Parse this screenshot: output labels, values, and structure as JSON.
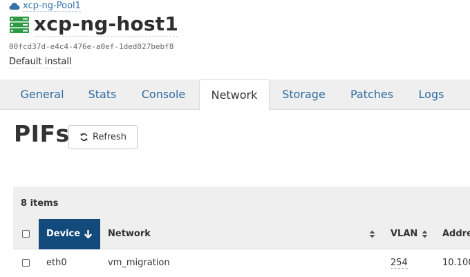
{
  "header": {
    "pool_name": "xcp-ng-Pool1",
    "host_name": "xcp-ng-host1",
    "uuid": "00fcd37d-e4c4-476e-a0ef-1ded027bebf8",
    "description": "Default install"
  },
  "tabs": [
    {
      "label": "General"
    },
    {
      "label": "Stats"
    },
    {
      "label": "Console"
    },
    {
      "label": "Network"
    },
    {
      "label": "Storage"
    },
    {
      "label": "Patches"
    },
    {
      "label": "Logs"
    }
  ],
  "active_tab": "Network",
  "section": {
    "title": "PIFs",
    "refresh_label": "Refresh"
  },
  "table": {
    "item_count": "8 items",
    "columns": {
      "device": "Device",
      "network": "Network",
      "vlan": "VLAN",
      "address": "Addre"
    },
    "rows": [
      {
        "device": "eth0",
        "network": "vm_migration",
        "vlan": "254",
        "address": "10.100"
      }
    ]
  },
  "colors": {
    "accent": "#134a7c",
    "link": "#2e6aa1",
    "server_icon": "#2f9a46"
  },
  "icons": {
    "pool": "cloud-icon",
    "host": "server-icon",
    "refresh": "refresh-icon",
    "sort_desc": "arrow-down-icon",
    "sortable": "sort-icon"
  }
}
